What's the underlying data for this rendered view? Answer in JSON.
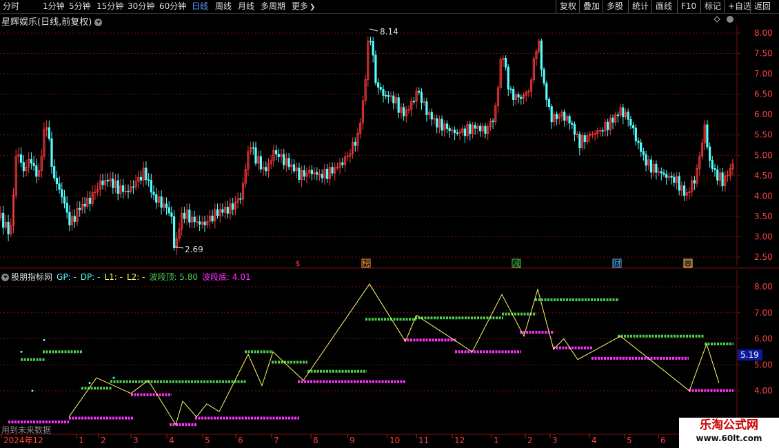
{
  "toolbar": {
    "periods": [
      "分时",
      "1分钟",
      "5分钟",
      "15分钟",
      "30分钟",
      "60分钟",
      "日线",
      "周线",
      "月线",
      "多周期",
      "更多"
    ],
    "active": "日线",
    "more_arrow": "❯",
    "right_buttons": [
      "复权",
      "叠加",
      "多股",
      "统计",
      "画线",
      "F10",
      "标记",
      "+自选",
      "返回"
    ]
  },
  "main": {
    "title": "星辉娱乐(日线,前复权)",
    "high_label": "8.14",
    "low_label": "2.69",
    "axis": [
      "8.00",
      "7.50",
      "7.00",
      "6.50",
      "6.00",
      "5.50",
      "5.00",
      "4.50",
      "4.00",
      "3.50",
      "3.00",
      "2.50"
    ],
    "events": [
      {
        "label": "$",
        "color": "#ff3b3b"
      },
      {
        "label": "榜",
        "color": "#ff9a3c"
      },
      {
        "label": "减",
        "color": "#4cd04c"
      },
      {
        "label": "财",
        "color": "#5ab4ff"
      },
      {
        "label": "回",
        "color": "#ffcc66"
      }
    ]
  },
  "indicator": {
    "name": "股朋指标网",
    "gp": "GP: -",
    "dp": "DP: -",
    "l1": "L1: -",
    "l2": "L2: -",
    "top_label": "波段顶: 5.80",
    "bottom_label": "波段底: 4.01",
    "axis": [
      "8.00",
      "7.00",
      "6.00",
      "5.00",
      "4.00"
    ],
    "current_value": "5.19",
    "future_note": "用到未来数据"
  },
  "xaxis": [
    "2024年12",
    "1",
    "2",
    "3",
    "4",
    "5",
    "6",
    "7",
    "8",
    "9",
    "10",
    "11",
    "12",
    "1",
    "2",
    "3",
    "4",
    "5",
    "6"
  ],
  "watermark": {
    "line1": "乐淘公式网",
    "line2": "www.60lt.com"
  },
  "colors": {
    "up": "#ff3b3b",
    "down": "#54ffff",
    "grid": "#7a1010",
    "top": "#4cd04c",
    "bottom": "#ff33ff",
    "zigzag": "#ffff66"
  },
  "chart_data": {
    "type": "line",
    "title": "星辉娱乐(日线,前复权)",
    "ylim": [
      2.3,
      8.4
    ],
    "price_path": [
      [
        0,
        3.5
      ],
      [
        15,
        3.05
      ],
      [
        25,
        5.3
      ],
      [
        32,
        4.6
      ],
      [
        45,
        4.9
      ],
      [
        55,
        4.4
      ],
      [
        67,
        5.9
      ],
      [
        77,
        4.5
      ],
      [
        90,
        4.0
      ],
      [
        102,
        3.3
      ],
      [
        115,
        3.7
      ],
      [
        130,
        3.9
      ],
      [
        145,
        4.3
      ],
      [
        158,
        4.4
      ],
      [
        170,
        4.2
      ],
      [
        185,
        4.1
      ],
      [
        195,
        4.3
      ],
      [
        210,
        4.6
      ],
      [
        222,
        4.0
      ],
      [
        235,
        3.8
      ],
      [
        248,
        3.6
      ],
      [
        253,
        2.69
      ],
      [
        265,
        3.6
      ],
      [
        280,
        3.4
      ],
      [
        295,
        3.3
      ],
      [
        315,
        3.6
      ],
      [
        335,
        3.7
      ],
      [
        350,
        4.0
      ],
      [
        362,
        5.3
      ],
      [
        372,
        4.9
      ],
      [
        385,
        4.6
      ],
      [
        398,
        5.1
      ],
      [
        410,
        4.9
      ],
      [
        425,
        4.7
      ],
      [
        435,
        4.5
      ],
      [
        450,
        4.6
      ],
      [
        465,
        4.5
      ],
      [
        480,
        4.6
      ],
      [
        495,
        4.8
      ],
      [
        505,
        5.0
      ],
      [
        520,
        5.5
      ],
      [
        528,
        6.5
      ],
      [
        536,
        8.14
      ],
      [
        545,
        6.8
      ],
      [
        555,
        6.5
      ],
      [
        570,
        6.4
      ],
      [
        585,
        6.0
      ],
      [
        595,
        6.2
      ],
      [
        606,
        6.6
      ],
      [
        618,
        6.1
      ],
      [
        632,
        5.8
      ],
      [
        645,
        5.7
      ],
      [
        660,
        5.55
      ],
      [
        675,
        5.6
      ],
      [
        690,
        5.7
      ],
      [
        705,
        5.6
      ],
      [
        718,
        6.0
      ],
      [
        728,
        7.6
      ],
      [
        740,
        6.5
      ],
      [
        755,
        6.4
      ],
      [
        768,
        6.6
      ],
      [
        780,
        7.9
      ],
      [
        790,
        6.6
      ],
      [
        800,
        5.9
      ],
      [
        815,
        6.0
      ],
      [
        828,
        5.8
      ],
      [
        840,
        5.3
      ],
      [
        855,
        5.5
      ],
      [
        870,
        5.6
      ],
      [
        885,
        5.8
      ],
      [
        900,
        6.1
      ],
      [
        912,
        5.9
      ],
      [
        925,
        5.3
      ],
      [
        938,
        4.8
      ],
      [
        950,
        4.65
      ],
      [
        965,
        4.5
      ],
      [
        980,
        4.4
      ],
      [
        995,
        4.0
      ],
      [
        1010,
        4.5
      ],
      [
        1022,
        5.7
      ],
      [
        1030,
        4.8
      ],
      [
        1040,
        4.5
      ],
      [
        1050,
        4.35
      ],
      [
        1063,
        4.8
      ]
    ],
    "indicator_ylim": [
      2.5,
      8.6
    ],
    "zigzag": [
      [
        100,
        3.0
      ],
      [
        140,
        4.5
      ],
      [
        190,
        3.9
      ],
      [
        215,
        4.4
      ],
      [
        255,
        2.7
      ],
      [
        265,
        3.6
      ],
      [
        285,
        3.0
      ],
      [
        300,
        3.5
      ],
      [
        318,
        3.2
      ],
      [
        360,
        5.4
      ],
      [
        380,
        4.2
      ],
      [
        396,
        5.5
      ],
      [
        440,
        4.4
      ],
      [
        536,
        8.1
      ],
      [
        588,
        5.9
      ],
      [
        604,
        6.9
      ],
      [
        685,
        5.5
      ],
      [
        728,
        7.7
      ],
      [
        760,
        6.1
      ],
      [
        780,
        7.9
      ],
      [
        803,
        5.6
      ],
      [
        818,
        6.0
      ],
      [
        838,
        5.2
      ],
      [
        900,
        6.1
      ],
      [
        1000,
        4.0
      ],
      [
        1025,
        5.8
      ],
      [
        1043,
        4.3
      ]
    ],
    "top_segments": [
      [
        30,
        65,
        5.2
      ],
      [
        62,
        120,
        5.5
      ],
      [
        118,
        162,
        4.1
      ],
      [
        160,
        358,
        4.35
      ],
      [
        355,
        396,
        5.5
      ],
      [
        394,
        446,
        5.1
      ],
      [
        446,
        532,
        4.75
      ],
      [
        530,
        604,
        6.75
      ],
      [
        602,
        730,
        6.8
      ],
      [
        728,
        778,
        6.95
      ],
      [
        776,
        898,
        7.5
      ],
      [
        896,
        1022,
        6.1
      ],
      [
        1022,
        1064,
        5.8
      ]
    ],
    "bottom_segments": [
      [
        12,
        100,
        2.8
      ],
      [
        100,
        193,
        2.95
      ],
      [
        190,
        249,
        3.85
      ],
      [
        246,
        285,
        2.7
      ],
      [
        283,
        434,
        2.95
      ],
      [
        432,
        588,
        4.35
      ],
      [
        586,
        662,
        5.95
      ],
      [
        660,
        756,
        5.5
      ],
      [
        754,
        804,
        6.25
      ],
      [
        802,
        860,
        5.65
      ],
      [
        858,
        999,
        5.25
      ],
      [
        999,
        1064,
        4.01
      ]
    ],
    "scatter_dots": [
      [
        31,
        5.5
      ],
      [
        47,
        4.0
      ],
      [
        64,
        5.95
      ],
      [
        130,
        4.3
      ],
      [
        165,
        4.5
      ]
    ]
  }
}
